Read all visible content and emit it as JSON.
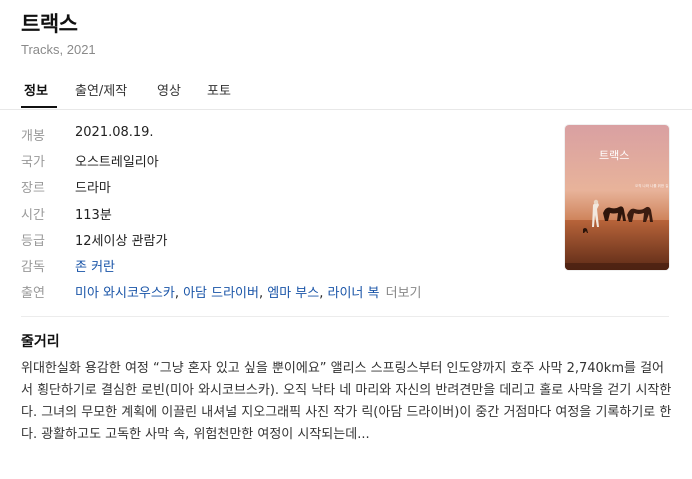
{
  "title": "트랙스",
  "subtitle": "Tracks, 2021",
  "tabs": [
    {
      "label": "정보",
      "active": true
    },
    {
      "label": "출연/제작",
      "active": false
    },
    {
      "label": "영상",
      "active": false
    },
    {
      "label": "포토",
      "active": false
    }
  ],
  "info": {
    "release": {
      "label": "개봉",
      "value": "2021.08.19."
    },
    "country": {
      "label": "국가",
      "value": "오스트레일리아"
    },
    "genre": {
      "label": "장르",
      "value": "드라마"
    },
    "runtime": {
      "label": "시간",
      "value": "113분"
    },
    "rating": {
      "label": "등급",
      "value": "12세이상 관람가"
    },
    "director": {
      "label": "감독",
      "value": "존 커란"
    },
    "cast": {
      "label": "출연",
      "names": [
        "미아 와시코우스카",
        "아담 드라이버",
        "엠마 부스",
        "라이너 복"
      ],
      "separator": ", ",
      "more": "더보기"
    }
  },
  "poster": {
    "title_text": "트랙스",
    "small_text": "오직 나와 나를 위한 길"
  },
  "synopsis": {
    "heading": "줄거리",
    "text": "위대한실화 용감한 여정 “그냥 혼자 있고 싶을 뿐이에요” 앨리스 스프링스부터 인도양까지 호주 사막 2,740km를 걸어서 횡단하기로 결심한 로빈(미아 와시코브스카). 오직 낙타 네 마리와 자신의 반려견만을 데리고 홀로 사막을 걷기 시작한다. 그녀의 무모한 계획에 이끌린 내셔널 지오그래픽 사진 작가 릭(아담 드라이버)이 중간 거점마다 여정을 기록하기로 한다. 광활하고도 고독한 사막 속, 위험천만한 여정이 시작되는데..."
  },
  "colors": {
    "link": "#1a55a8",
    "label": "#999999",
    "divider": "#ececec"
  }
}
